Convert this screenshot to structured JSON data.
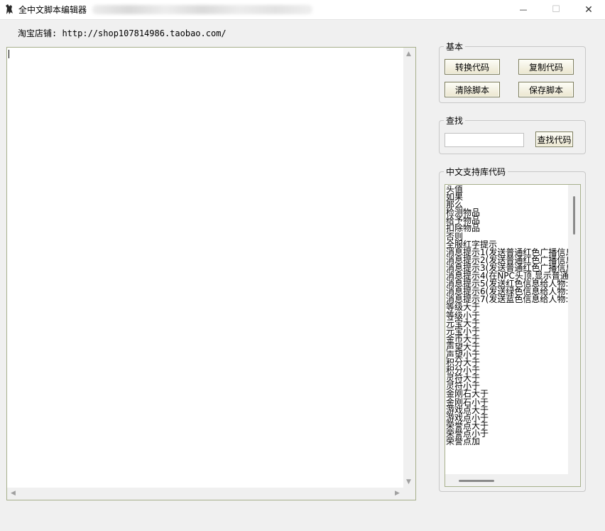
{
  "window": {
    "title": "全中文脚本编辑器",
    "minimize_glyph": "—",
    "maximize_glyph": "☐",
    "close_glyph": "✕"
  },
  "shop": {
    "text": "淘宝店铺: http://shop107814986.taobao.com/"
  },
  "editor": {
    "value": ""
  },
  "basic": {
    "label": "基本",
    "convert_label": "转换代码",
    "copy_label": "复制代码",
    "clear_label": "清除脚本",
    "save_label": "保存脚本"
  },
  "find": {
    "label": "查找",
    "value": "",
    "button_label": "查找代码"
  },
  "library": {
    "label": "中文支持库代码",
    "items": [
      "头值",
      "如果",
      "那么",
      "检测物品",
      "给予物品",
      "扣除物品",
      "否则",
      "全服红字提示",
      "消息提示1(发送普通红色广播信息",
      "消息提示2(发送普通红色广播信息",
      "消息提示3(发送普通红色广播信息",
      "消息提示4(在NPC头顶,显示普通",
      "消息提示5(发送红色信息给人物:",
      "消息提示6(发送绿色信息给人物:",
      "消息提示7(发送蓝色信息给人物:",
      "等级大于",
      "等级小于",
      "元宝大于",
      "元宝小于",
      "金币大于",
      "声望大于",
      "声望小于",
      "积分大于",
      "积分小于",
      "灵符大于",
      "灵符小于",
      "金刚石大于",
      "金刚石小于",
      "游戏点大于",
      "游戏点小于",
      "荣誉点大于",
      "荣誉点小于",
      "荣誉点加"
    ]
  },
  "icons": {
    "app": "app-logo-icon",
    "scroll_up": "▲",
    "scroll_down": "▼",
    "scroll_left": "◀",
    "scroll_right": "▶"
  }
}
